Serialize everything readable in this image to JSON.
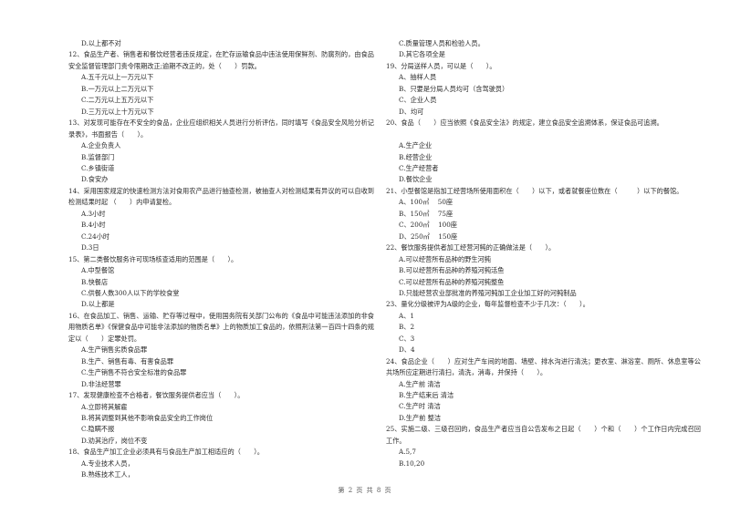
{
  "left_column": {
    "continuation_options": [
      "D.以上都不对"
    ],
    "questions": [
      {
        "number": "12",
        "stem": "12、食品生产者、销售者和餐饮经营者违反规定，在贮存运输食品中违法使用保鲜剂、防腐剂的，由食品安全监督管理部门责令限期改正;逾期不改正的，处（　　）罚款。",
        "options": [
          "A.五千元以上一万元以下",
          "B.一万元以上二万元以下",
          "C.二万元以上五万元以下",
          "D.三万元以上十万元以下"
        ]
      },
      {
        "number": "13",
        "stem": "13、对发现可能存在不安全的食品，企业应组织相关人员进行分析评估，同时填写《食品安全风险分析记录表》，书面报告（　　）。",
        "options": [
          "A.企业负责人",
          "B.监督部门",
          "C.乡镇街道",
          "D.食安办"
        ]
      },
      {
        "number": "14",
        "stem": "14、采用国家规定的快速检测方法对食用农产品进行抽查检测，被抽查人对检测结果有异议的可以自收到检测结果时起 （　　）内申请复检。",
        "options": [
          "A.3小时",
          "B.4小时",
          "C.24小时",
          "D.3日"
        ]
      },
      {
        "number": "15",
        "stem": "15、第二类餐饮服务许可现场核查适用的范围是（　　）。",
        "options": [
          "A.中型餐馆",
          "B.快餐店",
          "C.供餐人数300人以下的学校食堂",
          "D.以上都是"
        ]
      },
      {
        "number": "16",
        "stem": "16、在食品加工、销售、运输、贮存等过程中，使用国务院有关部门公布的《食品中可能违法添加的非食用物质名单》《保健食品中可能非法添加的物质名单》上的物质加工食品的，依照刑法第一百四十四条的规定以（　　）定罪处罚。",
        "options": [
          "A.生产销售劣质食品罪",
          "B.生产、销售有毒、有害食品罪",
          "C.生产销售不符合安全标准的食品罪",
          "D.非法经营罪"
        ]
      },
      {
        "number": "17",
        "stem": "17、发现健康检查不合格者，餐饮服务提供者应当（　　）。",
        "options": [
          "A.立即将其解雇",
          "B.将其调整到其他不影响食品安全的工作岗位",
          "C.隐瞒不报",
          "D.劝其治疗，岗位不变"
        ]
      },
      {
        "number": "18",
        "stem": "18、食品生产加工企业必须具有与食品生产加工相适应的（　　）。",
        "options": [
          "A.专业技术人员，",
          "B.熟练技术工人，"
        ]
      }
    ]
  },
  "right_column": {
    "continuation_options": [
      "C.质量管理人员和检验人员。",
      "D.其它各项全是"
    ],
    "questions": [
      {
        "number": "19",
        "stem": "19、分局送样人员，可以是（　　）。",
        "options": [
          "A、抽样人员",
          "B、只要是分局人员均可（含驾驶员）",
          "C、企业人员",
          "D、均可"
        ]
      },
      {
        "number": "20",
        "stem": "20、食品（　　）应当依照《食品安全法》的规定，建立食品安全追溯体系，保证食品可追溯。",
        "blank_after_stem": true,
        "options": [
          "A.生产企业",
          "B.经营企业",
          "C.生产经营者",
          "D.餐饮企业"
        ]
      },
      {
        "number": "21",
        "stem": "21、小型餐馆是指加工经营场所使用面积在（　　）以下，或者就餐座位数在（　　　）以下的餐馆。",
        "options": [
          "A、100㎡　 50座",
          "B、150㎡　 75座",
          "C、200㎡　 100座",
          "D、250㎡　 150座"
        ]
      },
      {
        "number": "22",
        "stem": "22、餐饮服务提供者加工经营河鲀的正确做法是（　　）。",
        "options": [
          "A.可以经营所有品种的野生河鲀",
          "B.可以经营所有品种的养殖河鲀活鱼",
          "C.可以经营所有品种的养殖河鲀整鱼",
          "D.只能经营农业部批准的养殖河鲀加工企业加工好的河鲀制品"
        ]
      },
      {
        "number": "23",
        "stem": "23、量化分级被评为A级的企业，每年监督检查不少于几次：（　　）。",
        "options": [
          "A、1",
          "B、2",
          "C、3",
          "D、4"
        ]
      },
      {
        "number": "24",
        "stem": "24、食品企业（　　）应对生产车间的地面、墙壁、排水沟进行清洗；更衣室、淋浴室、厕所、休息室等公共场所应定期进行清扫，清洗，消毒，并保持（　　）。",
        "options": [
          "A.生产前 清洁",
          "B.生产结束后 清洁",
          "C.生产时 清洁",
          "D.生产前 整洁"
        ]
      },
      {
        "number": "25",
        "stem": "25、实施二级、三级召回的，食品生产者应当自公告发布之日起（　　）个和（　　）个工作日内完成召回工作。",
        "options": [
          "A.5,7",
          "B.10,20"
        ]
      }
    ]
  },
  "footer": {
    "page_label": "第 2 页 共 8 页"
  }
}
